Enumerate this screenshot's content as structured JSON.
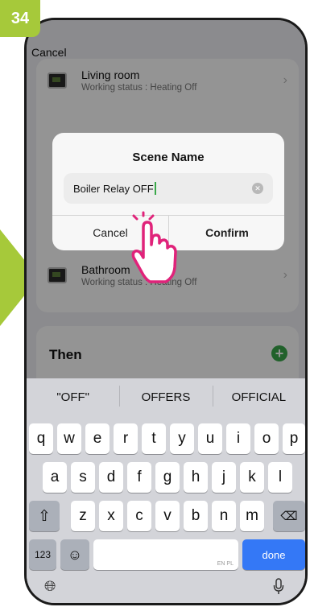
{
  "step": {
    "number": "34"
  },
  "header": {
    "cancel_label": "Cancel"
  },
  "devices": [
    {
      "name": "Living room",
      "status": "Working status : Heating Off"
    },
    {
      "name": "Bathroom",
      "status": "Working status : Heating Off"
    }
  ],
  "then_section": {
    "title": "Then",
    "add_icon": "plus-circle-icon"
  },
  "dialog": {
    "title": "Scene Name",
    "input_value": "Boiler Relay OFF",
    "cancel_label": "Cancel",
    "confirm_label": "Confirm"
  },
  "keyboard": {
    "suggestions": [
      "\"OFF\"",
      "OFFERS",
      "OFFICIAL"
    ],
    "row1": [
      "q",
      "w",
      "e",
      "r",
      "t",
      "y",
      "u",
      "i",
      "o",
      "p"
    ],
    "row2": [
      "a",
      "s",
      "d",
      "f",
      "g",
      "h",
      "j",
      "k",
      "l"
    ],
    "row3": [
      "z",
      "x",
      "c",
      "v",
      "b",
      "n",
      "m"
    ],
    "numbers_label": "123",
    "space_lang_label": "EN PL",
    "done_label": "done"
  },
  "colors": {
    "accent_green": "#3aa84a",
    "badge_green": "#a6c93a",
    "done_blue": "#3478f6",
    "hand_pink": "#e0237a"
  }
}
